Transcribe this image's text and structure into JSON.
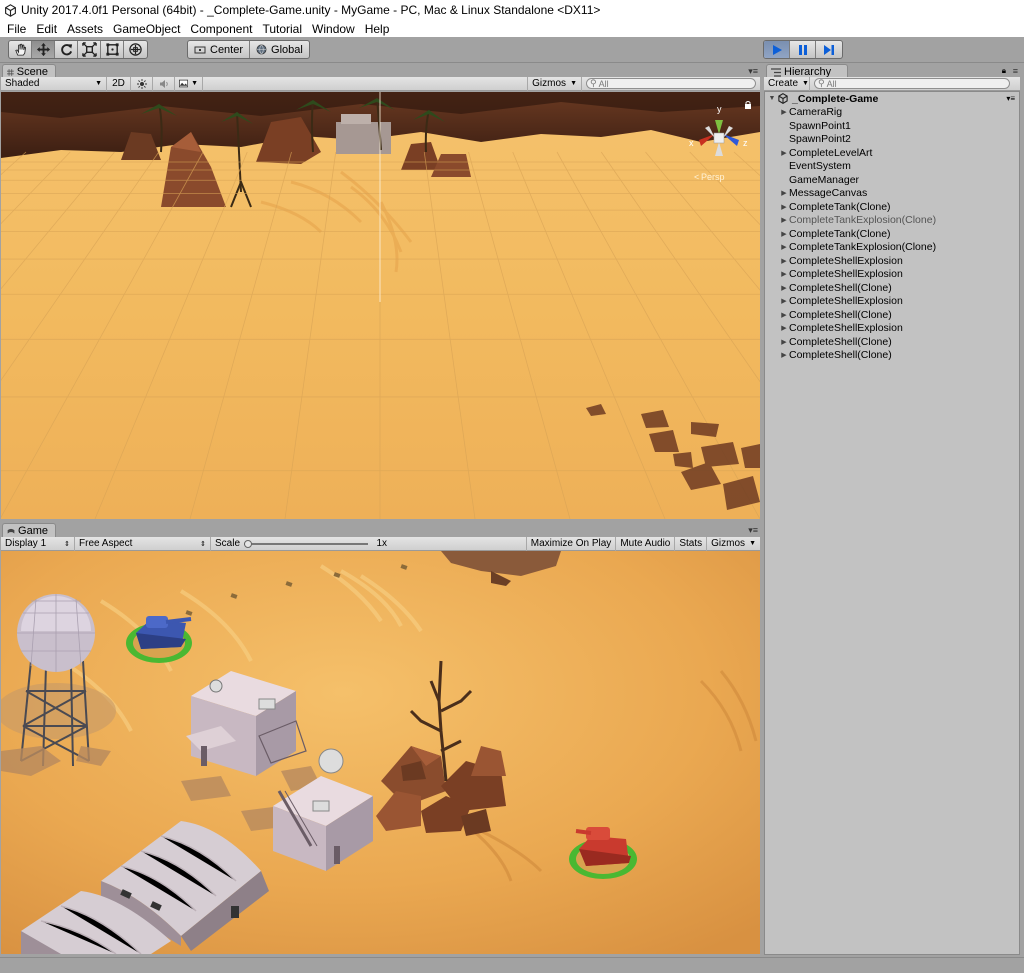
{
  "window": {
    "title": "Unity 2017.4.0f1 Personal (64bit) - _Complete-Game.unity - MyGame - PC, Mac & Linux Standalone <DX11>"
  },
  "menu": [
    "File",
    "Edit",
    "Assets",
    "GameObject",
    "Component",
    "Tutorial",
    "Window",
    "Help"
  ],
  "toolbar": {
    "tools": [
      "hand-tool-icon",
      "move-tool-icon",
      "rotate-tool-icon",
      "scale-tool-icon",
      "rect-tool-icon",
      "transform-tool-icon"
    ],
    "pivot_label": "Center",
    "space_label": "Global",
    "play": [
      "play-icon",
      "pause-icon",
      "step-icon"
    ]
  },
  "scene": {
    "tab_label": "Scene",
    "shading": "Shaded",
    "mode_2d": "2D",
    "gizmos": "Gizmos",
    "search_placeholder": "All",
    "persp_label": "Persp",
    "axis_y": "y",
    "axis_x": "x",
    "axis_z": "z"
  },
  "game": {
    "tab_label": "Game",
    "display": "Display 1",
    "aspect": "Free Aspect",
    "scale_label": "Scale",
    "scale_value": "1x",
    "scale_level": 0,
    "maximize": "Maximize On Play",
    "mute": "Mute Audio",
    "stats": "Stats",
    "gizmos": "Gizmos"
  },
  "hierarchy": {
    "tab_label": "Hierarchy",
    "create": "Create",
    "search_placeholder": "All",
    "scene_name": "_Complete-Game",
    "items": [
      {
        "label": "CameraRig",
        "foldout": true,
        "dim": false
      },
      {
        "label": "SpawnPoint1",
        "foldout": false,
        "dim": false
      },
      {
        "label": "SpawnPoint2",
        "foldout": false,
        "dim": false
      },
      {
        "label": "CompleteLevelArt",
        "foldout": true,
        "dim": false
      },
      {
        "label": "EventSystem",
        "foldout": false,
        "dim": false
      },
      {
        "label": "GameManager",
        "foldout": false,
        "dim": false
      },
      {
        "label": "MessageCanvas",
        "foldout": true,
        "dim": false
      },
      {
        "label": "CompleteTank(Clone)",
        "foldout": true,
        "dim": false
      },
      {
        "label": "CompleteTankExplosion(Clone)",
        "foldout": true,
        "dim": true
      },
      {
        "label": "CompleteTank(Clone)",
        "foldout": true,
        "dim": false
      },
      {
        "label": "CompleteTankExplosion(Clone)",
        "foldout": true,
        "dim": false
      },
      {
        "label": "CompleteShellExplosion",
        "foldout": true,
        "dim": false
      },
      {
        "label": "CompleteShellExplosion",
        "foldout": true,
        "dim": false
      },
      {
        "label": "CompleteShell(Clone)",
        "foldout": true,
        "dim": false
      },
      {
        "label": "CompleteShellExplosion",
        "foldout": true,
        "dim": false
      },
      {
        "label": "CompleteShell(Clone)",
        "foldout": true,
        "dim": false
      },
      {
        "label": "CompleteShellExplosion",
        "foldout": true,
        "dim": false
      },
      {
        "label": "CompleteShell(Clone)",
        "foldout": true,
        "dim": false
      },
      {
        "label": "CompleteShell(Clone)",
        "foldout": true,
        "dim": false
      }
    ]
  }
}
